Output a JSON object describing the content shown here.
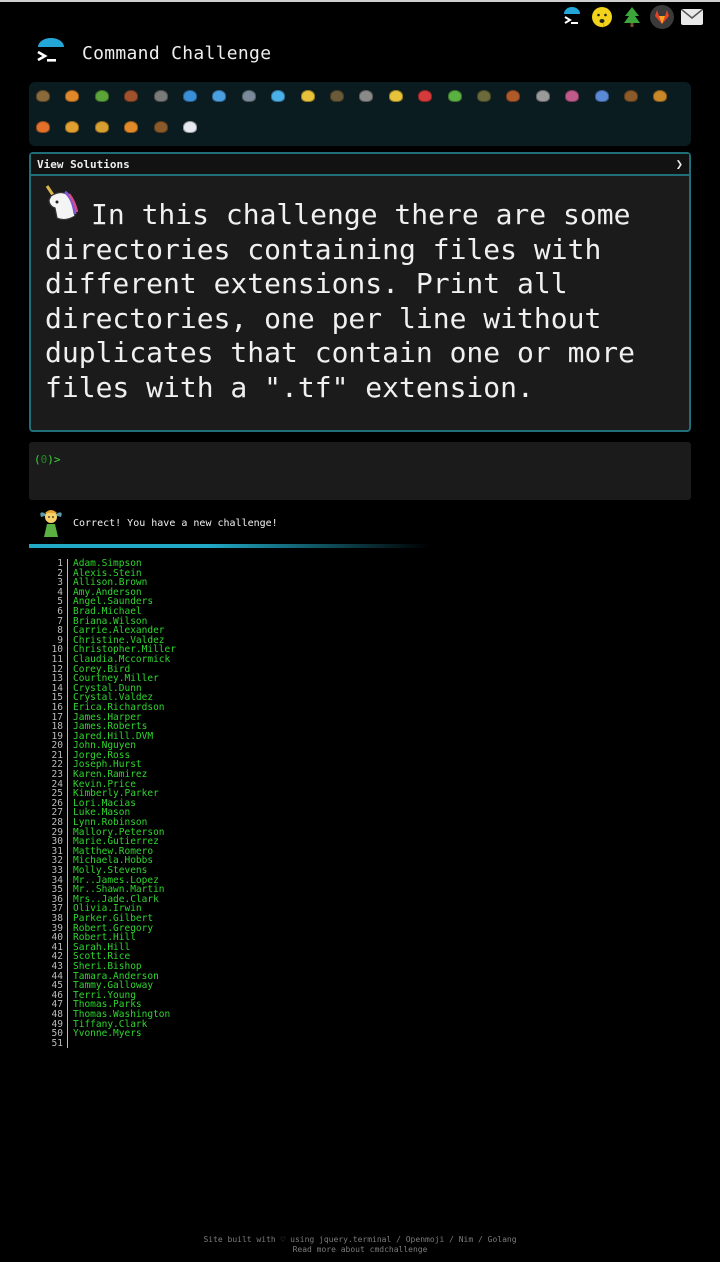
{
  "header": {
    "title": "Command Challenge",
    "logo_icon": "terminal-umbrella-icon"
  },
  "top_icons": [
    {
      "name": "terminal-umbrella-icon"
    },
    {
      "name": "sad-face-icon"
    },
    {
      "name": "christmas-tree-icon"
    },
    {
      "name": "gitlab-icon"
    },
    {
      "name": "envelope-icon"
    }
  ],
  "badges": [
    {
      "name": "snail-icon",
      "color": "#8a6a3a"
    },
    {
      "name": "butterfly-icon",
      "color": "#e0892a"
    },
    {
      "name": "caterpillar-icon",
      "color": "#5aa43a"
    },
    {
      "name": "ant-icon",
      "color": "#a0522d"
    },
    {
      "name": "spider-web-icon",
      "color": "#7a7a7a"
    },
    {
      "name": "whale-icon",
      "color": "#3a8fd6"
    },
    {
      "name": "dolphin-icon",
      "color": "#4aa0e0"
    },
    {
      "name": "shark-icon",
      "color": "#7a8a9a"
    },
    {
      "name": "fish-icon",
      "color": "#4ab0e8"
    },
    {
      "name": "tropical-fish-icon",
      "color": "#e8c23a"
    },
    {
      "name": "turtle-icon",
      "color": "#6a5a3a"
    },
    {
      "name": "wolf-icon",
      "color": "#8a8a8a"
    },
    {
      "name": "bee-icon",
      "color": "#e8c23a"
    },
    {
      "name": "ladybug-icon",
      "color": "#d63a3a"
    },
    {
      "name": "lizard-icon",
      "color": "#5ab040"
    },
    {
      "name": "cricket-icon",
      "color": "#6a6a3a"
    },
    {
      "name": "scorpion-icon",
      "color": "#b05a2a"
    },
    {
      "name": "fly-icon",
      "color": "#9a9a9a"
    },
    {
      "name": "worm-icon",
      "color": "#c05a8a"
    },
    {
      "name": "microbe-icon",
      "color": "#5a8ad6"
    },
    {
      "name": "monkey-icon",
      "color": "#8a5a2a"
    },
    {
      "name": "dog-icon",
      "color": "#c8882a"
    },
    {
      "name": "fox-icon",
      "color": "#e0702a"
    },
    {
      "name": "cat-icon",
      "color": "#e0a030"
    },
    {
      "name": "lion-icon",
      "color": "#d8a030"
    },
    {
      "name": "tiger-icon",
      "color": "#e08a2a"
    },
    {
      "name": "horse-icon",
      "color": "#8a5a2a"
    },
    {
      "name": "unicorn-icon",
      "color": "#e8e8f0"
    }
  ],
  "challenge": {
    "view_solutions": "View Solutions",
    "arrow": "❯",
    "text": "In this challenge there are some directories containing files with different extensions. Print all directories, one per line without duplicates that contain one or more files with a \".tf\" extension."
  },
  "terminal": {
    "prompt_open": "(",
    "prompt_num": "0",
    "prompt_close": ")>"
  },
  "result": {
    "message": "Correct! You have a new challenge!"
  },
  "listing": [
    "Adam.Simpson",
    "Alexis.Stein",
    "Allison.Brown",
    "Amy.Anderson",
    "Angel.Saunders",
    "Brad.Michael",
    "Briana.Wilson",
    "Carrie.Alexander",
    "Christine.Valdez",
    "Christopher.Miller",
    "Claudia.Mccormick",
    "Corey.Bird",
    "Courtney.Miller",
    "Crystal.Dunn",
    "Crystal.Valdez",
    "Erica.Richardson",
    "James.Harper",
    "James.Roberts",
    "Jared.Hill.DVM",
    "John.Nguyen",
    "Jorge.Ross",
    "Joseph.Hurst",
    "Karen.Ramirez",
    "Kevin.Price",
    "Kimberly.Parker",
    "Lori.Macias",
    "Luke.Mason",
    "Lynn.Robinson",
    "Mallory.Peterson",
    "Marie.Gutierrez",
    "Matthew.Romero",
    "Michaela.Hobbs",
    "Molly.Stevens",
    "Mr..James.Lopez",
    "Mr..Shawn.Martin",
    "Mrs..Jade.Clark",
    "Olivia.Irwin",
    "Parker.Gilbert",
    "Robert.Gregory",
    "Robert.Hill",
    "Sarah.Hill",
    "Scott.Rice",
    "Sheri.Bishop",
    "Tamara.Anderson",
    "Tammy.Galloway",
    "Terri.Young",
    "Thomas.Parks",
    "Thomas.Washington",
    "Tiffany.Clark",
    "Yvonne.Myers",
    ""
  ],
  "footer": {
    "line1": "Site built with ♡ using jquery.terminal / Openmoji / Nim / Golang",
    "line2": "Read more about cmdchallenge"
  }
}
